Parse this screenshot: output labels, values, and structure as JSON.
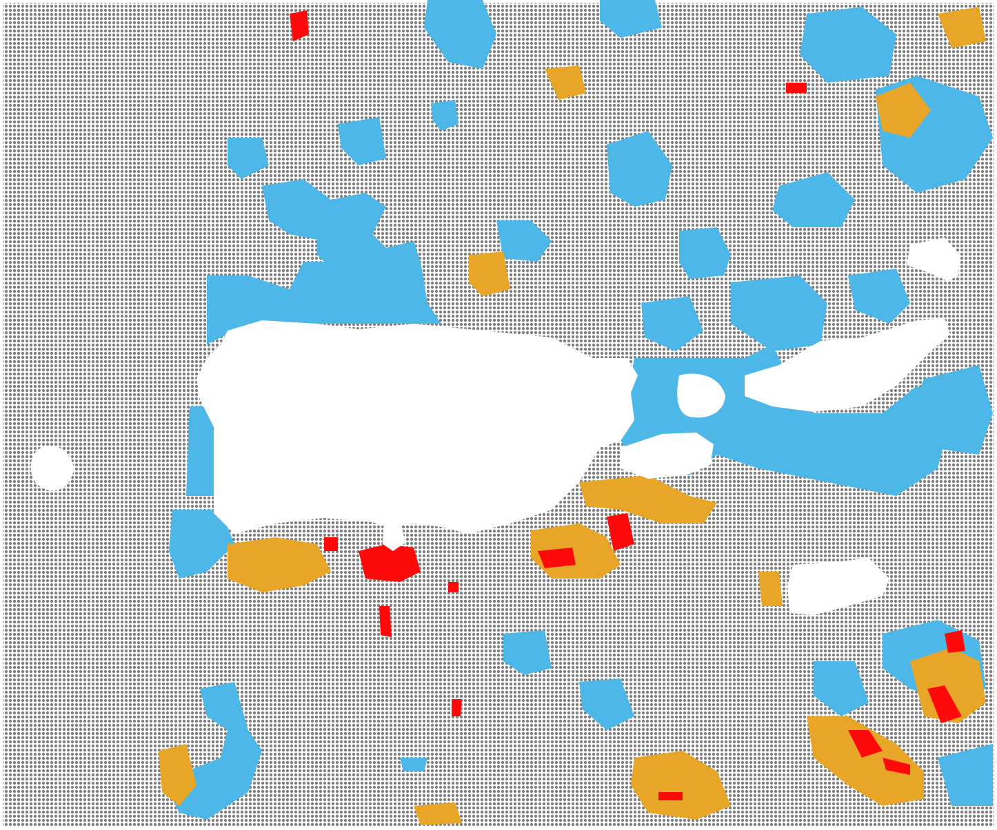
{
  "map": {
    "colors": {
      "background": "#ffffff",
      "grid_dot": "#7f7f7f",
      "blue": "#4db8e8",
      "orange": "#e8a628",
      "red": "#ff0a0a",
      "land": "#ffffff"
    },
    "legend": [],
    "labels": []
  }
}
